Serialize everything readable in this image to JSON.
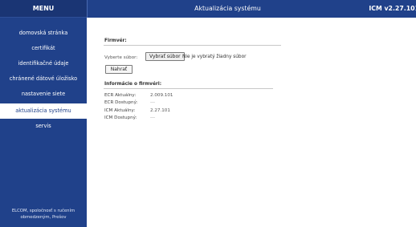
{
  "sidebar": {
    "header": "MENU",
    "items": [
      {
        "label": "domovská stránka"
      },
      {
        "label": "certifikát"
      },
      {
        "label": "identifikačné údaje"
      },
      {
        "label": "chránené dátové úložisko"
      },
      {
        "label": "nastavenie siete"
      },
      {
        "label": "aktualizácia systému",
        "active": true
      },
      {
        "label": "servis"
      }
    ],
    "footer": "ELCOM, spoločnosť s ručením obmedzeným, Prešov"
  },
  "topbar": {
    "title": "Aktualizácia systému",
    "version": "ICM v2.27.101"
  },
  "firmware": {
    "section_title": "Firmvér:",
    "select_label": "Vyberte súbor:",
    "choose_button": "Vybrať súbor",
    "file_status": "Nie je vybratý žiadny súbor",
    "upload_button": "Nahrať"
  },
  "info": {
    "section_title": "Informácie o firmvéri:",
    "rows": [
      {
        "label": "ECR Aktuálny:",
        "value": "2.009.101"
      },
      {
        "label": "ECR Dostupný:",
        "value": "---"
      },
      {
        "label": "ICM Aktuálny:",
        "value": "2.27.101"
      },
      {
        "label": "ICM Dostupný:",
        "value": "---"
      }
    ]
  },
  "colors": {
    "sidebar_bg": "#20418a",
    "active_item_bg": "#ffffff",
    "content_bg": "#ffffff"
  }
}
